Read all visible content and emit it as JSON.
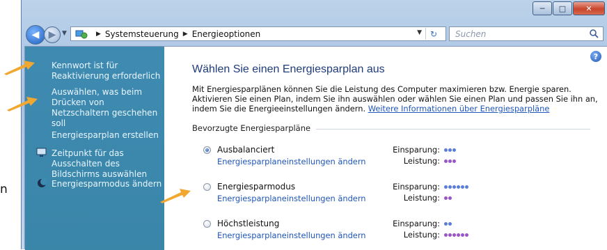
{
  "colors": {
    "link": "#1f56b8",
    "title": "#1e3b7a",
    "sidebar_bg": "#3f8ab1",
    "arrow": "#f0a830",
    "dot_saving": "#5a7ed8",
    "dot_performance": "#9a55c8"
  },
  "window": {
    "controls": [
      "minimize-icon",
      "maximize-icon",
      "close-icon"
    ]
  },
  "address_bar": {
    "crumbs": [
      "Systemsteuerung",
      "Energieoptionen"
    ],
    "search_placeholder": "Suchen"
  },
  "sidebar": {
    "items": [
      {
        "label": "Kennwort ist für Reaktivierung erforderlich",
        "icon": null
      },
      {
        "label": "Auswählen, was beim Drücken von Netzschaltern geschehen soll",
        "icon": null
      },
      {
        "label": "Energiesparplan erstellen",
        "icon": null
      },
      {
        "label": "Zeitpunkt für das Ausschalten des Bildschirms auswählen",
        "icon": "monitor-icon"
      },
      {
        "label": "Energiesparmodus ändern",
        "icon": "moon-icon"
      }
    ]
  },
  "main": {
    "title": "Wählen Sie einen Energiesparplan aus",
    "description": "Mit Energiesparplänen können Sie die Leistung des Computer maximieren bzw. Energie sparen. Aktivieren Sie einen Plan, indem Sie ihn auswählen oder wählen Sie einen Plan und passen Sie ihn an, indem Sie die Energieeinstellungen ändern.",
    "more_link": "Weitere Informationen über Energiesparpläne",
    "group_label": "Bevorzugte Energiesparpläne",
    "saving_label": "Einsparung:",
    "performance_label": "Leistung:",
    "plans": [
      {
        "name": "Ausbalanciert",
        "selected": true,
        "link": "Energiesparplaneinstellungen ändern",
        "saving": 3,
        "performance": 3
      },
      {
        "name": "Energiesparmodus",
        "selected": false,
        "link": "Energiesparplaneinstellungen ändern",
        "saving": 6,
        "performance": 2
      },
      {
        "name": "Höchstleistung",
        "selected": false,
        "link": "Energiesparplaneinstellungen ändern",
        "saving": 2,
        "performance": 6
      }
    ]
  },
  "edge_text": "n"
}
